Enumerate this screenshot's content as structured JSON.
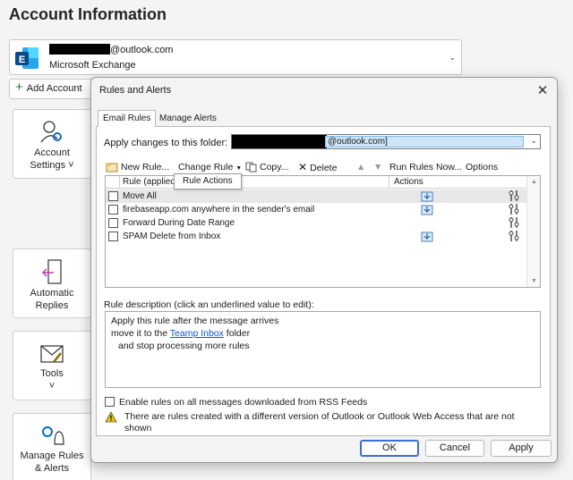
{
  "backstage": {
    "title": "Account Information",
    "account": {
      "email_suffix": "@outlook.com",
      "type": "Microsoft Exchange"
    },
    "add_account_label": "Add Account",
    "tiles": [
      {
        "label1": "Account",
        "label2": "Settings ˅"
      },
      {
        "label1": "Automatic",
        "label2": "Replies"
      },
      {
        "label1": "Tools",
        "label2": "˅"
      },
      {
        "label1": "Manage Rules",
        "label2": "& Alerts"
      }
    ]
  },
  "dialog": {
    "title": "Rules and Alerts",
    "close_glyph": "✕",
    "tabs": [
      "Email Rules",
      "Manage Alerts"
    ],
    "apply_label": "Apply changes to this folder:",
    "folder_suffix": "@outlook.com]",
    "toolbar": {
      "new_rule": "New Rule...",
      "change_rule": "Change Rule",
      "copy": "Copy...",
      "delete": "Delete",
      "run_rules": "Run Rules Now...",
      "options": "Options"
    },
    "tooltip": "Rule Actions",
    "columns": [
      "Rule (applied",
      "Actions"
    ],
    "rules": [
      {
        "name": "Move All",
        "has_action": true,
        "selected": true
      },
      {
        "name": "firebaseapp.com anywhere in the sender's email",
        "has_action": true,
        "selected": false
      },
      {
        "name": "Forward During Date Range",
        "has_action": false,
        "selected": false
      },
      {
        "name": "SPAM Delete from Inbox",
        "has_action": true,
        "selected": false
      }
    ],
    "desc_label": "Rule description (click an underlined value to edit):",
    "description": {
      "line1": "Apply this rule after the message arrives",
      "line2_pre": "move it to the ",
      "line2_link": "Teamp Inbox",
      "line2_post": " folder",
      "line3": "and stop processing more rules"
    },
    "rss_label": "Enable rules on all messages downloaded from RSS Feeds",
    "warning": "There are rules created with a different version of Outlook or Outlook Web Access that are not shown",
    "buttons": {
      "ok": "OK",
      "cancel": "Cancel",
      "apply": "Apply"
    }
  },
  "colors": {
    "accent": "#0078d4",
    "link": "#0b57c5",
    "selection": "#cde6f7"
  }
}
